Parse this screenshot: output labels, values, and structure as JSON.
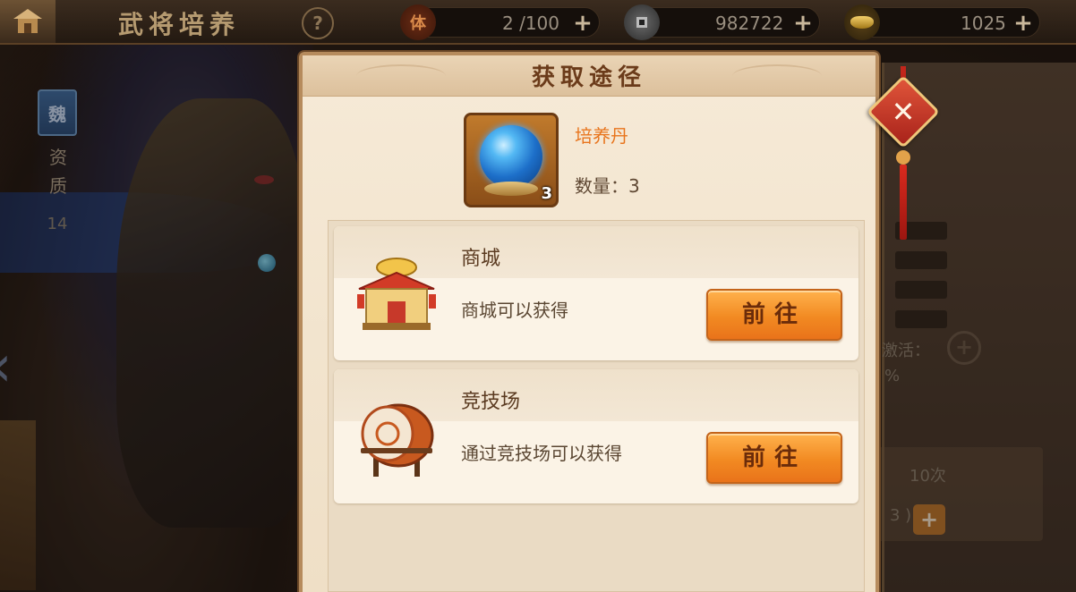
{
  "header": {
    "title": "武将培养",
    "help_label": "?",
    "stamina": {
      "icon_label": "体",
      "value": "2 /100"
    },
    "coins": {
      "value": "982722"
    },
    "ingots": {
      "value": "1025"
    }
  },
  "hero_panel": {
    "badge_text": "魏",
    "stat_label": "资质",
    "stat_value": "14"
  },
  "right_panel": {
    "activate_text": "激活：",
    "percent_text": "%",
    "times_text": "10次",
    "count_text": "3 )"
  },
  "modal": {
    "title": "获取途径",
    "item": {
      "name": "培养丹",
      "quantity_label": "数量：3",
      "count_badge": "3"
    },
    "sources": [
      {
        "name": "商城",
        "description": "商城可以获得",
        "button_label": "前往"
      },
      {
        "name": "竞技场",
        "description": "通过竞技场可以获得",
        "button_label": "前往"
      }
    ]
  },
  "icons": {
    "home": "home-icon",
    "stamina": "stamina-icon",
    "coin": "coin-icon",
    "ingot": "gold-ingot-icon",
    "close": "close-icon",
    "shop": "shop-icon",
    "arena": "drum-icon",
    "zoom": "zoom-in-icon"
  },
  "colors": {
    "accent_orange": "#f28a22",
    "item_name": "#e8741c",
    "close_red": "#c0301f"
  }
}
